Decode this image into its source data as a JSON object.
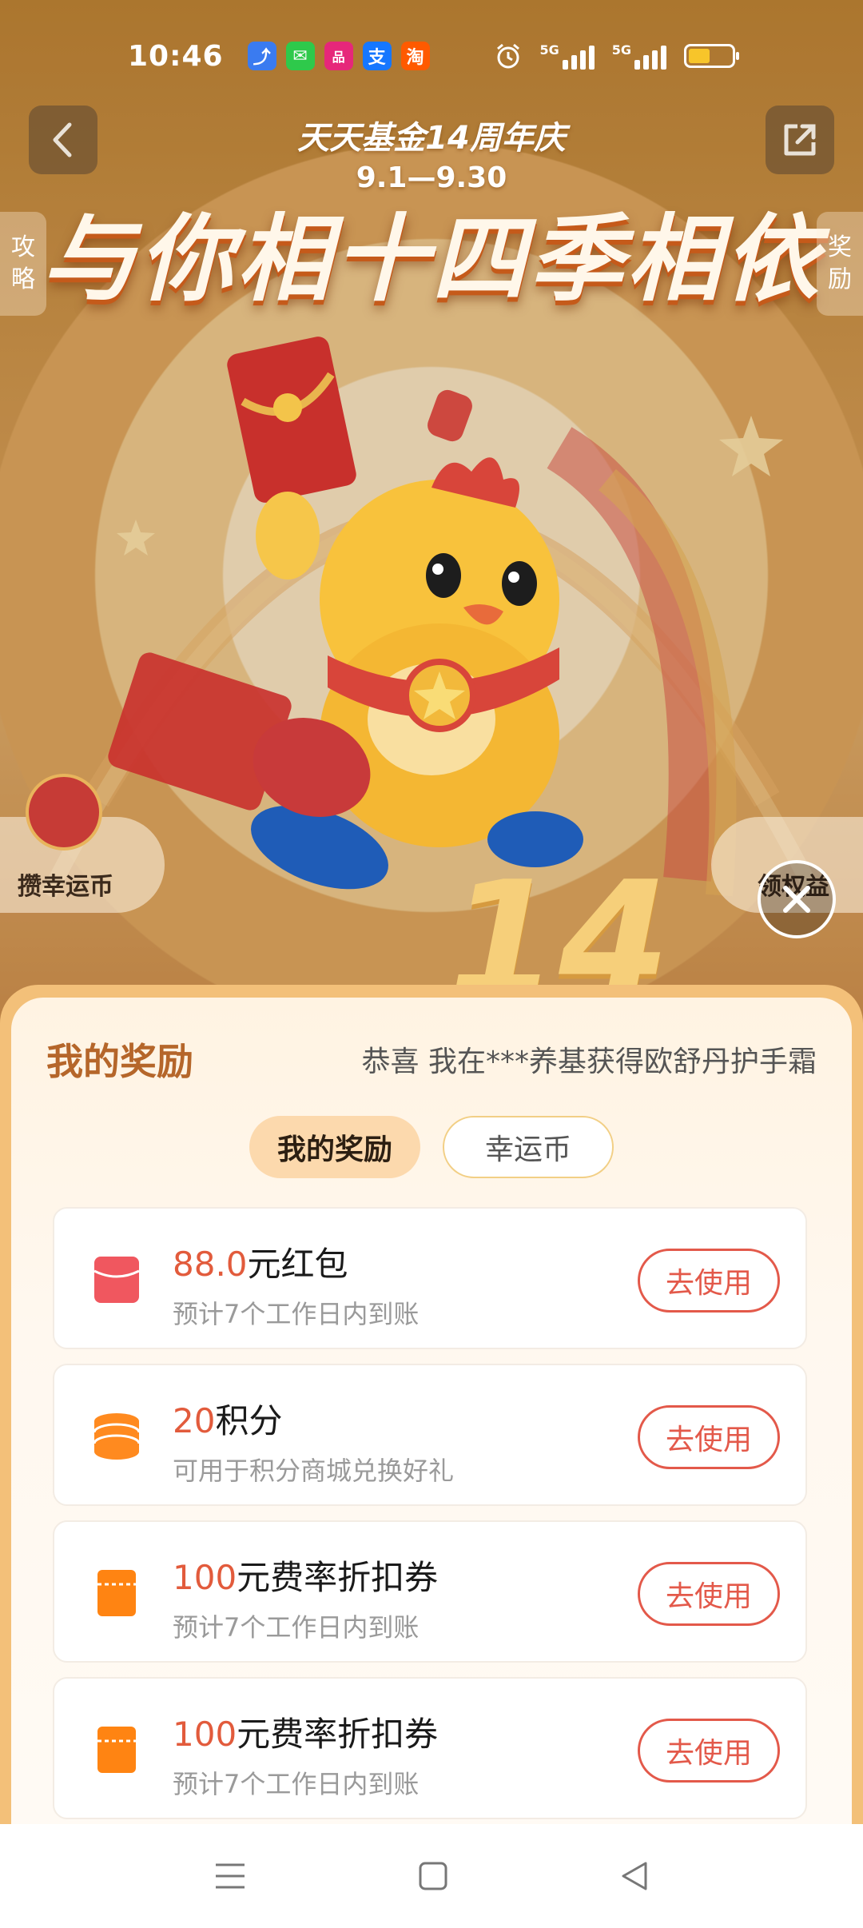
{
  "status_bar": {
    "time": "10:46",
    "apps": [
      {
        "icon": "maps-app-icon",
        "glyph": "⤴",
        "color": "#3a7bf0"
      },
      {
        "icon": "messages-app-icon",
        "glyph": "✉",
        "color": "#2ec94b"
      },
      {
        "icon": "shopping-app-icon",
        "glyph": "品",
        "color": "#e6277a"
      },
      {
        "icon": "alipay-app-icon",
        "glyph": "支",
        "color": "#1677ff"
      },
      {
        "icon": "taobao-app-icon",
        "glyph": "淘",
        "color": "#ff5a00"
      }
    ],
    "network1": "5G",
    "network2": "5G",
    "battery_level": 0.5
  },
  "header": {
    "back_icon": "chevron-left-icon",
    "share_icon": "share-icon",
    "left_tab": [
      "攻",
      "略"
    ],
    "right_tab": [
      "奖",
      "励"
    ]
  },
  "banner": {
    "anniversary": "天天基金14周年庆",
    "dates": "9.1—9.30",
    "headline": "与你相十四季相依",
    "big_number": "14"
  },
  "floating": {
    "left_label": "攒幸运币",
    "right_label": "领权益"
  },
  "sheet": {
    "title": "我的奖励",
    "marquee": "恭喜 我在***养基获得欧舒丹护手霜",
    "tabs": [
      {
        "label": "我的奖励",
        "active": true
      },
      {
        "label": "幸运币",
        "active": false
      }
    ],
    "rewards": [
      {
        "icon": "red-packet-icon",
        "amount": "88.0",
        "title": "元红包",
        "desc": "预计7个工作日内到账",
        "button": "去使用"
      },
      {
        "icon": "coins-icon",
        "amount": "20",
        "title": "积分",
        "desc": "可用于积分商城兑换好礼",
        "button": "去使用"
      },
      {
        "icon": "coupon-icon",
        "amount": "100",
        "title": "元费率折扣券",
        "desc": "预计7个工作日内到账",
        "button": "去使用"
      },
      {
        "icon": "coupon-icon",
        "amount": "100",
        "title": "元费率折扣券",
        "desc": "预计7个工作日内到账",
        "button": "去使用"
      }
    ]
  },
  "colors": {
    "accent": "#e25b3c",
    "title_brown": "#b5662a",
    "button_red": "#e3594a"
  }
}
